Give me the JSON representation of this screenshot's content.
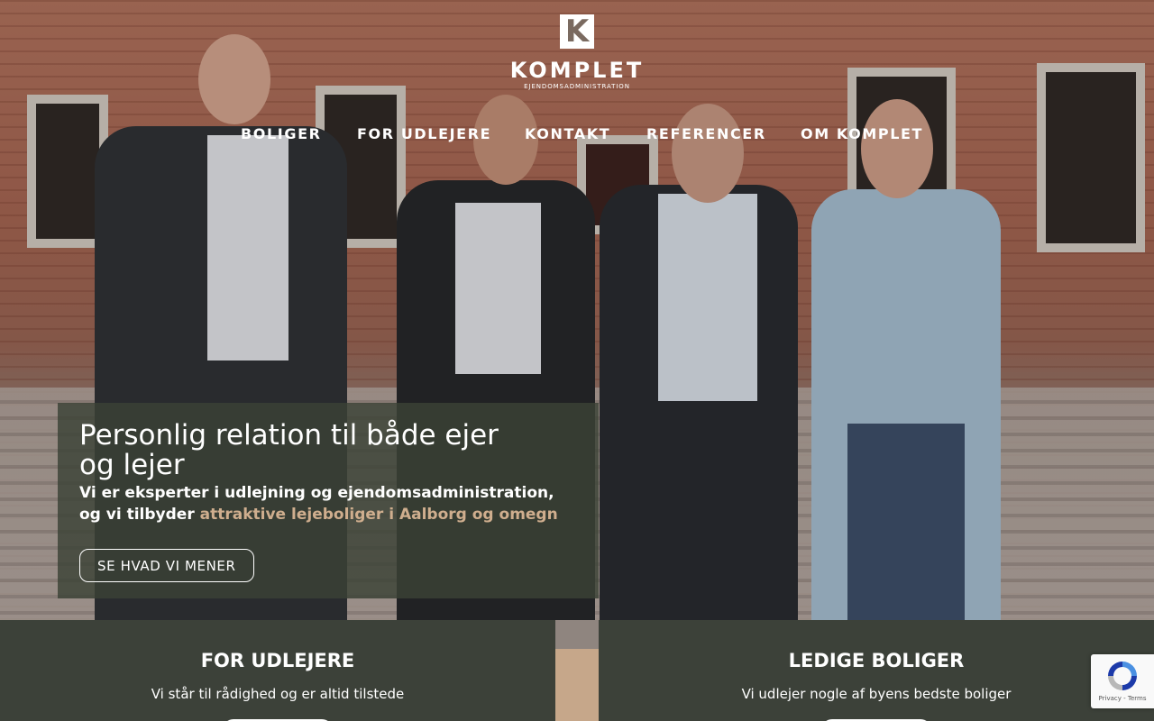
{
  "brand": {
    "mark": "K",
    "name": "KOMPLET",
    "tagline": "EJENDOMSADMINISTRATION"
  },
  "nav": {
    "items": [
      {
        "label": "BOLIGER"
      },
      {
        "label": "FOR UDLEJERE"
      },
      {
        "label": "KONTAKT"
      },
      {
        "label": "REFERENCER"
      },
      {
        "label": "OM KOMPLET"
      }
    ]
  },
  "hero": {
    "headline": "Personlig relation til både ejer og lejer",
    "body_line1": "Vi er eksperter i udlejning og ejendomsadministration,",
    "body_line2_prefix": "og vi tilbyder ",
    "body_line2_accent": "attraktive lejeboliger i Aalborg og omegn",
    "cta_label": "SE HVAD VI MENER"
  },
  "panels": [
    {
      "title": "FOR UDLEJERE",
      "subtitle": "Vi står til rådighed og er altid tilstede"
    },
    {
      "title": "LEDIGE BOLIGER",
      "subtitle": "Vi udlejer nogle af byens bedste boliger"
    }
  ],
  "recaptcha": {
    "links": "Privacy - Terms"
  },
  "colors": {
    "panel_bg": "#3c4139",
    "accent_tan": "#c6a78a",
    "link_accent": "#cfae8e",
    "text": "#ffffff"
  }
}
